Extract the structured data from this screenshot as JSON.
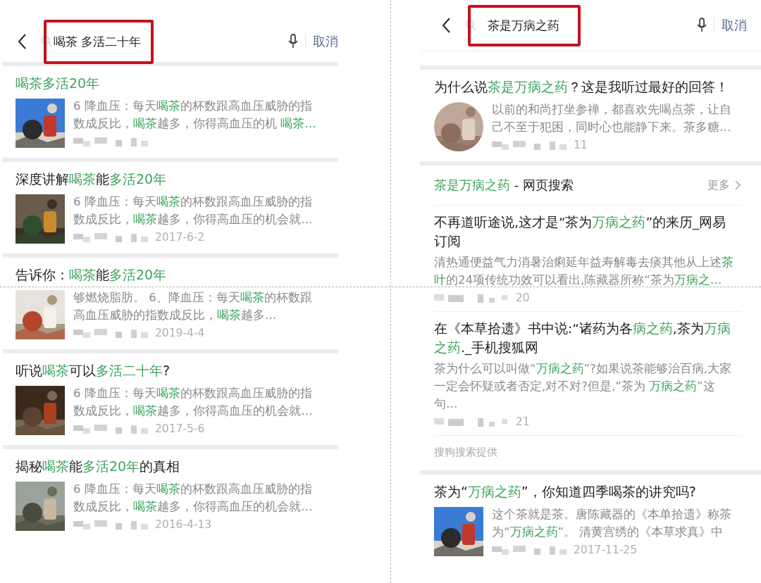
{
  "panels": [
    {
      "query": "喝茶 多活二十年",
      "cancel": "取消",
      "blocks": [
        {
          "kind": "article",
          "round": false,
          "title": [
            {
              "t": "喝茶多活20年",
              "hl": true
            }
          ],
          "snippet": [
            {
              "t": "6 降血压：每天"
            },
            {
              "t": "喝茶",
              "hl": true
            },
            {
              "t": "的杯数跟高血压威胁的指数成反比，"
            },
            {
              "t": "喝茶",
              "hl": true
            },
            {
              "t": "越多，你得高血压的机 "
            },
            {
              "t": "喝茶…",
              "hl": true
            }
          ]
        },
        {
          "kind": "article",
          "round": false,
          "title": [
            {
              "t": "深度讲解"
            },
            {
              "t": "喝茶",
              "hl": true
            },
            {
              "t": "能"
            },
            {
              "t": "多活20年",
              "hl": true
            }
          ],
          "snippet": [
            {
              "t": "6 降血压：每天"
            },
            {
              "t": "喝茶",
              "hl": true
            },
            {
              "t": "的杯数跟高血压威胁的指数成反比，"
            },
            {
              "t": "喝茶",
              "hl": true
            },
            {
              "t": "越多，你得高血压的机会就…"
            }
          ],
          "meta": "2017-6-2"
        },
        {
          "kind": "article",
          "round": false,
          "title": [
            {
              "t": "告诉你："
            },
            {
              "t": "喝茶",
              "hl": true
            },
            {
              "t": "能"
            },
            {
              "t": "多活20年",
              "hl": true
            }
          ],
          "snippet": [
            {
              "t": "够燃烧脂肪。 6、降血压：每天"
            },
            {
              "t": "喝茶",
              "hl": true
            },
            {
              "t": "的杯数跟高血压威胁的指数成反比，"
            },
            {
              "t": "喝茶",
              "hl": true
            },
            {
              "t": "越多…"
            }
          ],
          "meta": "2019-4-4"
        },
        {
          "kind": "article",
          "round": false,
          "title": [
            {
              "t": "听说"
            },
            {
              "t": "喝茶",
              "hl": true
            },
            {
              "t": "可以"
            },
            {
              "t": "多活二十年",
              "hl": true
            },
            {
              "t": "?"
            }
          ],
          "snippet": [
            {
              "t": "6 降血压：每天"
            },
            {
              "t": "喝茶",
              "hl": true
            },
            {
              "t": "的杯数跟高血压威胁的指数成反比，"
            },
            {
              "t": "喝茶",
              "hl": true
            },
            {
              "t": "越多，你得高血压的机会就…"
            }
          ],
          "meta": "2017-5-6"
        },
        {
          "kind": "article",
          "round": false,
          "title": [
            {
              "t": "揭秘"
            },
            {
              "t": "喝茶",
              "hl": true
            },
            {
              "t": "能"
            },
            {
              "t": "多活20年",
              "hl": true
            },
            {
              "t": "的真相"
            }
          ],
          "snippet": [
            {
              "t": "6 降血压：每天"
            },
            {
              "t": "喝茶",
              "hl": true
            },
            {
              "t": "的杯数跟高血压威胁的指数成反比，"
            },
            {
              "t": "喝茶",
              "hl": true
            },
            {
              "t": "越多，你得高血压的机会就…"
            }
          ],
          "meta": "2016-4-13"
        }
      ]
    },
    {
      "query": "茶是万病之药",
      "cancel": "取消",
      "blocks": [
        {
          "kind": "article",
          "round": true,
          "title": [
            {
              "t": "为什么说"
            },
            {
              "t": "茶是万病之药",
              "hl": true
            },
            {
              "t": "？这是我听过最好的回答！"
            }
          ],
          "snippet": [
            {
              "t": "以前的和尚打坐参禅，都喜欢先喝点茶，让自己不至于犯困，同时心也能静下来。茶多糖…"
            }
          ],
          "meta": "11"
        },
        {
          "kind": "web_section",
          "heading": [
            {
              "t": "茶是万病之药",
              "hl": true
            },
            {
              "t": " - 网页搜索"
            }
          ],
          "more": "更多",
          "items": [
            {
              "title": [
                {
                  "t": "不再道听途说,这才是“茶为"
                },
                {
                  "t": "万病之药",
                  "hl": true
                },
                {
                  "t": "”的来历_网易订阅"
                }
              ],
              "snippet": [
                {
                  "t": "清热通便益气力消暑治痢延年益寿解毒去痰其他从上述"
                },
                {
                  "t": "茶叶",
                  "hl": true
                },
                {
                  "t": "的24项传统功效可以看出,陈藏器所称“茶为"
                },
                {
                  "t": "万病之…",
                  "hl": true
                }
              ],
              "meta": "20"
            },
            {
              "title": [
                {
                  "t": "在《本草拾遗》书中说:“诸药为各"
                },
                {
                  "t": "病之药",
                  "hl": true
                },
                {
                  "t": ",茶为"
                },
                {
                  "t": "万病之药",
                  "hl": true
                },
                {
                  "t": "._手机搜狐网"
                }
              ],
              "snippet": [
                {
                  "t": "茶为什么可以叫做“"
                },
                {
                  "t": "万病之药",
                  "hl": true
                },
                {
                  "t": "”?如果说茶能够治百病,大家一定会怀疑或者否定,对不对?但是,“茶为 "
                },
                {
                  "t": "万病之药",
                  "hl": true
                },
                {
                  "t": "”这句…"
                }
              ],
              "meta": "21"
            }
          ],
          "footer": "搜狗搜索提供"
        },
        {
          "kind": "article",
          "round": false,
          "title": [
            {
              "t": "茶为“"
            },
            {
              "t": "万病之药",
              "hl": true
            },
            {
              "t": "”，你知道四季喝茶的讲究吗?"
            }
          ],
          "snippet": [
            {
              "t": "这个茶就是茶。唐陈藏器的《本单拾遗》称茶为“"
            },
            {
              "t": "万病之药",
              "hl": true
            },
            {
              "t": "”。 清黄宫绣的《本草求真》中"
            }
          ],
          "meta": "2017-11-25"
        }
      ]
    }
  ]
}
